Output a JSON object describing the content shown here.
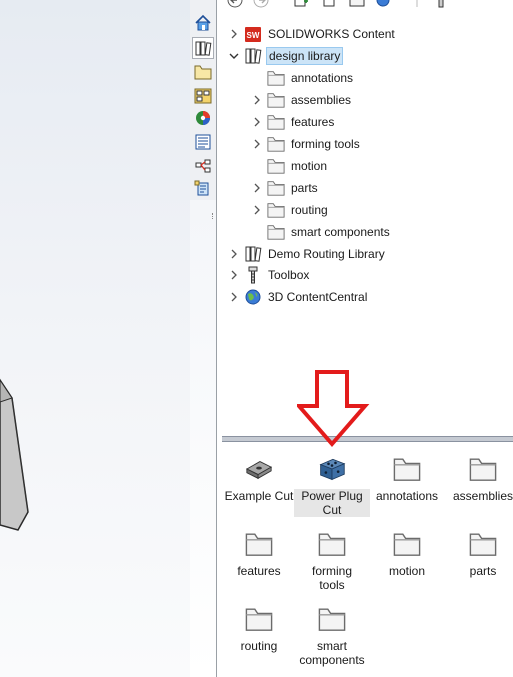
{
  "tree": [
    {
      "label": "SOLIDWORKS Content",
      "icon": "solidworks-content-icon",
      "expander": "collapsed",
      "level": 0
    },
    {
      "label": "design library",
      "icon": "design-library-icon",
      "expander": "expanded",
      "level": 0,
      "selected": true
    },
    {
      "label": "annotations",
      "icon": "folder-icon",
      "expander": "none",
      "level": 1
    },
    {
      "label": "assemblies",
      "icon": "folder-icon",
      "expander": "collapsed",
      "level": 1
    },
    {
      "label": "features",
      "icon": "folder-icon",
      "expander": "collapsed",
      "level": 1
    },
    {
      "label": "forming tools",
      "icon": "folder-icon",
      "expander": "collapsed",
      "level": 1
    },
    {
      "label": "motion",
      "icon": "folder-icon",
      "expander": "none",
      "level": 1
    },
    {
      "label": "parts",
      "icon": "folder-icon",
      "expander": "collapsed",
      "level": 1
    },
    {
      "label": "routing",
      "icon": "folder-icon",
      "expander": "collapsed",
      "level": 1
    },
    {
      "label": "smart components",
      "icon": "folder-icon",
      "expander": "none",
      "level": 1
    },
    {
      "label": "Demo Routing Library",
      "icon": "library-icon",
      "expander": "collapsed",
      "level": 0
    },
    {
      "label": "Toolbox",
      "icon": "toolbox-icon",
      "expander": "collapsed",
      "level": 0
    },
    {
      "label": "3D ContentCentral",
      "icon": "globe-icon",
      "expander": "collapsed",
      "level": 0
    }
  ],
  "grid": [
    {
      "line1": "Example Cut",
      "line2": "",
      "icon": "example-cut-part-icon"
    },
    {
      "line1": "Power Plug",
      "line2": "Cut",
      "icon": "power-plug-part-icon",
      "selected": true
    },
    {
      "line1": "annotations",
      "line2": "",
      "icon": "folder-icon"
    },
    {
      "line1": "assemblies",
      "line2": "",
      "icon": "folder-icon"
    },
    {
      "line1": "features",
      "line2": "",
      "icon": "folder-icon"
    },
    {
      "line1": "forming",
      "line2": "tools",
      "icon": "folder-icon"
    },
    {
      "line1": "motion",
      "line2": "",
      "icon": "folder-icon"
    },
    {
      "line1": "parts",
      "line2": "",
      "icon": "folder-icon"
    },
    {
      "line1": "routing",
      "line2": "",
      "icon": "folder-icon"
    },
    {
      "line1": "smart",
      "line2": "components",
      "icon": "folder-icon"
    }
  ],
  "side_tabs": [
    "home-tab-icon",
    "design-library-tab-icon",
    "file-explorer-tab-icon",
    "view-palette-tab-icon",
    "appearances-tab-icon",
    "custom-properties-tab-icon",
    "solidworks-forum-tab-icon",
    "property-tab-builder-icon"
  ],
  "toolbar_icons": [
    "back-icon",
    "forward-icon",
    "add-to-library-icon",
    "add-file-location-icon",
    "create-new-folder-icon",
    "refresh-icon",
    "separator-icon",
    "toolbox-settings-icon"
  ],
  "colors": {
    "accent_red": "#e31b1b",
    "selection": "#cce4f7",
    "folder": "#f3f3f3"
  }
}
